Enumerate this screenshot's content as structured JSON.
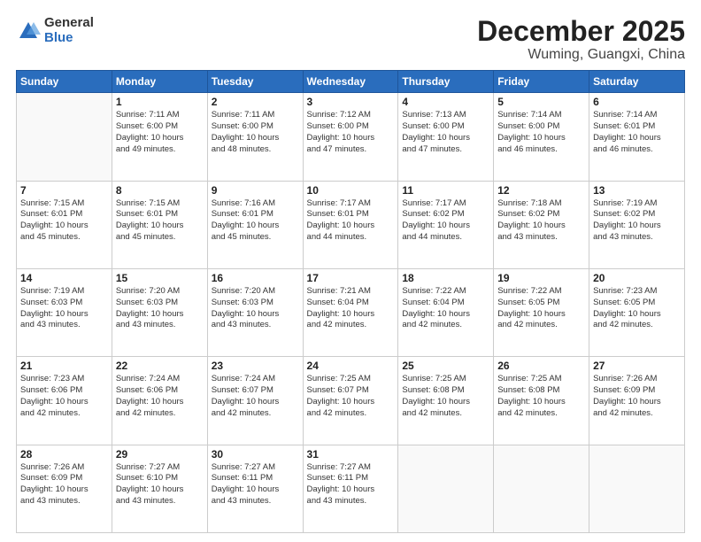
{
  "logo": {
    "general": "General",
    "blue": "Blue"
  },
  "header": {
    "month": "December 2025",
    "location": "Wuming, Guangxi, China"
  },
  "days_of_week": [
    "Sunday",
    "Monday",
    "Tuesday",
    "Wednesday",
    "Thursday",
    "Friday",
    "Saturday"
  ],
  "weeks": [
    [
      {
        "day": "",
        "info": ""
      },
      {
        "day": "1",
        "info": "Sunrise: 7:11 AM\nSunset: 6:00 PM\nDaylight: 10 hours\nand 49 minutes."
      },
      {
        "day": "2",
        "info": "Sunrise: 7:11 AM\nSunset: 6:00 PM\nDaylight: 10 hours\nand 48 minutes."
      },
      {
        "day": "3",
        "info": "Sunrise: 7:12 AM\nSunset: 6:00 PM\nDaylight: 10 hours\nand 47 minutes."
      },
      {
        "day": "4",
        "info": "Sunrise: 7:13 AM\nSunset: 6:00 PM\nDaylight: 10 hours\nand 47 minutes."
      },
      {
        "day": "5",
        "info": "Sunrise: 7:14 AM\nSunset: 6:00 PM\nDaylight: 10 hours\nand 46 minutes."
      },
      {
        "day": "6",
        "info": "Sunrise: 7:14 AM\nSunset: 6:01 PM\nDaylight: 10 hours\nand 46 minutes."
      }
    ],
    [
      {
        "day": "7",
        "info": "Sunrise: 7:15 AM\nSunset: 6:01 PM\nDaylight: 10 hours\nand 45 minutes."
      },
      {
        "day": "8",
        "info": "Sunrise: 7:15 AM\nSunset: 6:01 PM\nDaylight: 10 hours\nand 45 minutes."
      },
      {
        "day": "9",
        "info": "Sunrise: 7:16 AM\nSunset: 6:01 PM\nDaylight: 10 hours\nand 45 minutes."
      },
      {
        "day": "10",
        "info": "Sunrise: 7:17 AM\nSunset: 6:01 PM\nDaylight: 10 hours\nand 44 minutes."
      },
      {
        "day": "11",
        "info": "Sunrise: 7:17 AM\nSunset: 6:02 PM\nDaylight: 10 hours\nand 44 minutes."
      },
      {
        "day": "12",
        "info": "Sunrise: 7:18 AM\nSunset: 6:02 PM\nDaylight: 10 hours\nand 43 minutes."
      },
      {
        "day": "13",
        "info": "Sunrise: 7:19 AM\nSunset: 6:02 PM\nDaylight: 10 hours\nand 43 minutes."
      }
    ],
    [
      {
        "day": "14",
        "info": "Sunrise: 7:19 AM\nSunset: 6:03 PM\nDaylight: 10 hours\nand 43 minutes."
      },
      {
        "day": "15",
        "info": "Sunrise: 7:20 AM\nSunset: 6:03 PM\nDaylight: 10 hours\nand 43 minutes."
      },
      {
        "day": "16",
        "info": "Sunrise: 7:20 AM\nSunset: 6:03 PM\nDaylight: 10 hours\nand 43 minutes."
      },
      {
        "day": "17",
        "info": "Sunrise: 7:21 AM\nSunset: 6:04 PM\nDaylight: 10 hours\nand 42 minutes."
      },
      {
        "day": "18",
        "info": "Sunrise: 7:22 AM\nSunset: 6:04 PM\nDaylight: 10 hours\nand 42 minutes."
      },
      {
        "day": "19",
        "info": "Sunrise: 7:22 AM\nSunset: 6:05 PM\nDaylight: 10 hours\nand 42 minutes."
      },
      {
        "day": "20",
        "info": "Sunrise: 7:23 AM\nSunset: 6:05 PM\nDaylight: 10 hours\nand 42 minutes."
      }
    ],
    [
      {
        "day": "21",
        "info": "Sunrise: 7:23 AM\nSunset: 6:06 PM\nDaylight: 10 hours\nand 42 minutes."
      },
      {
        "day": "22",
        "info": "Sunrise: 7:24 AM\nSunset: 6:06 PM\nDaylight: 10 hours\nand 42 minutes."
      },
      {
        "day": "23",
        "info": "Sunrise: 7:24 AM\nSunset: 6:07 PM\nDaylight: 10 hours\nand 42 minutes."
      },
      {
        "day": "24",
        "info": "Sunrise: 7:25 AM\nSunset: 6:07 PM\nDaylight: 10 hours\nand 42 minutes."
      },
      {
        "day": "25",
        "info": "Sunrise: 7:25 AM\nSunset: 6:08 PM\nDaylight: 10 hours\nand 42 minutes."
      },
      {
        "day": "26",
        "info": "Sunrise: 7:25 AM\nSunset: 6:08 PM\nDaylight: 10 hours\nand 42 minutes."
      },
      {
        "day": "27",
        "info": "Sunrise: 7:26 AM\nSunset: 6:09 PM\nDaylight: 10 hours\nand 42 minutes."
      }
    ],
    [
      {
        "day": "28",
        "info": "Sunrise: 7:26 AM\nSunset: 6:09 PM\nDaylight: 10 hours\nand 43 minutes."
      },
      {
        "day": "29",
        "info": "Sunrise: 7:27 AM\nSunset: 6:10 PM\nDaylight: 10 hours\nand 43 minutes."
      },
      {
        "day": "30",
        "info": "Sunrise: 7:27 AM\nSunset: 6:11 PM\nDaylight: 10 hours\nand 43 minutes."
      },
      {
        "day": "31",
        "info": "Sunrise: 7:27 AM\nSunset: 6:11 PM\nDaylight: 10 hours\nand 43 minutes."
      },
      {
        "day": "",
        "info": ""
      },
      {
        "day": "",
        "info": ""
      },
      {
        "day": "",
        "info": ""
      }
    ]
  ]
}
